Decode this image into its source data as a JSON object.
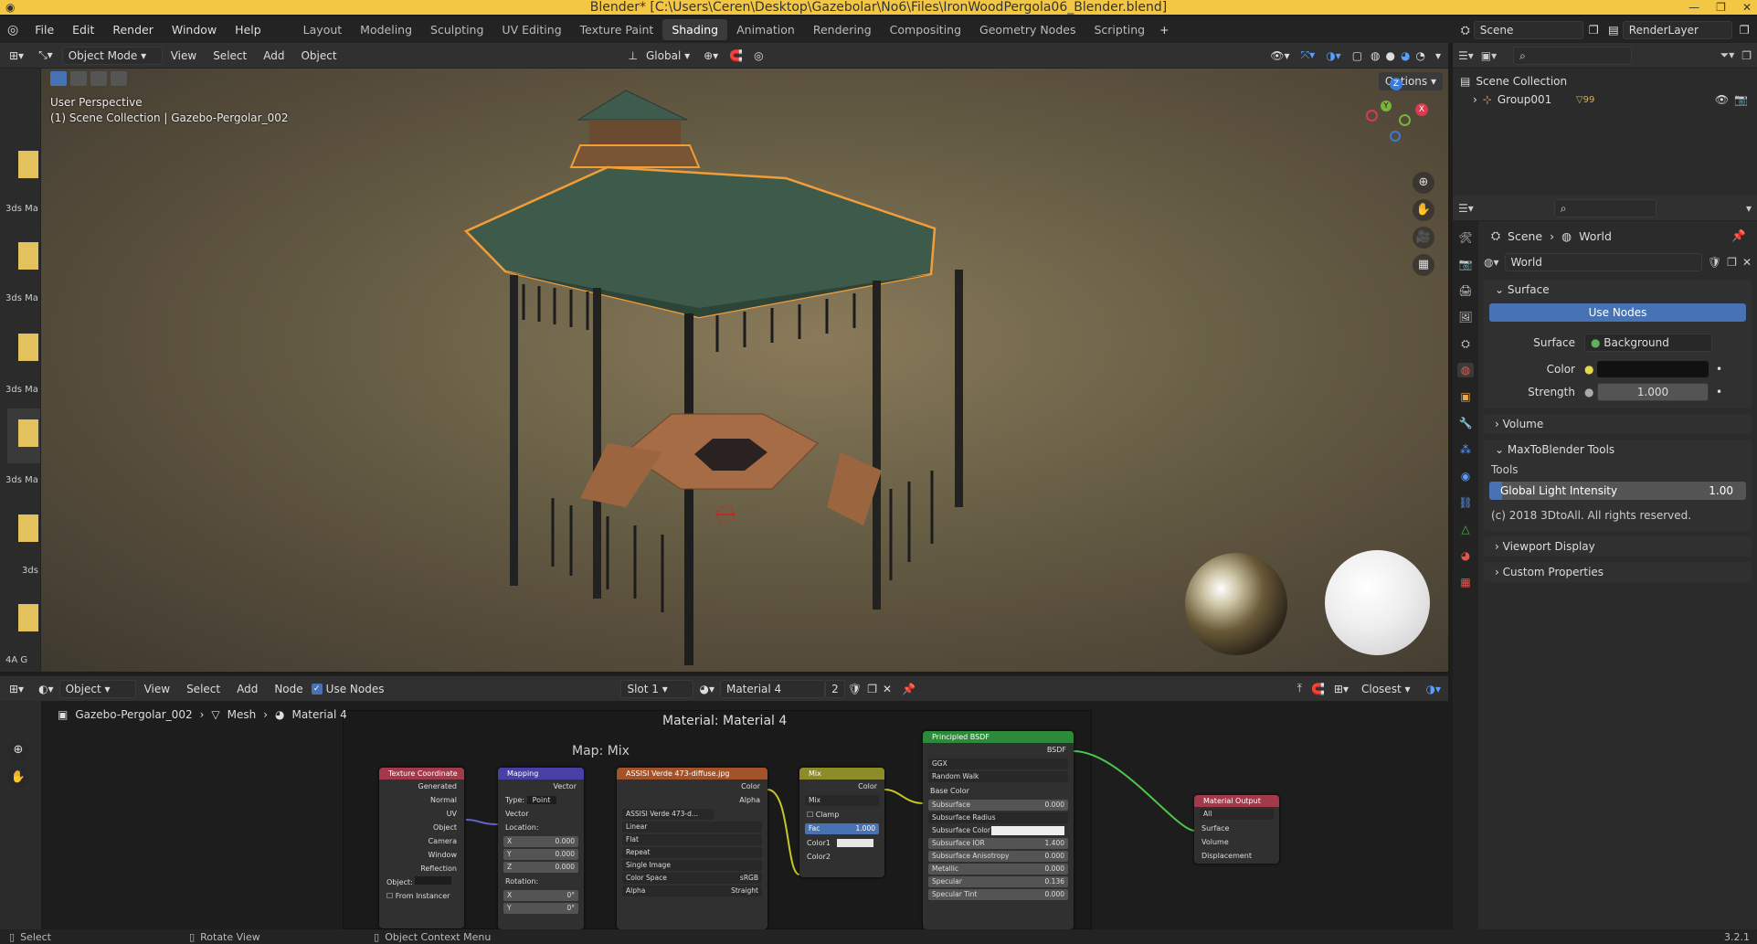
{
  "title_bar": {
    "text": "Blender* [C:\\Users\\Ceren\\Desktop\\Gazebolar\\No6\\Files\\IronWoodPergola06_Blender.blend]"
  },
  "menu": [
    "File",
    "Edit",
    "Render",
    "Window",
    "Help"
  ],
  "workspaces": [
    "Layout",
    "Modeling",
    "Sculpting",
    "UV Editing",
    "Texture Paint",
    "Shading",
    "Animation",
    "Rendering",
    "Compositing",
    "Geometry Nodes",
    "Scripting"
  ],
  "active_workspace": "Shading",
  "scene_field": "Scene",
  "renderlayer_field": "RenderLayer",
  "viewport_header": {
    "mode": "Object Mode",
    "menu": [
      "View",
      "Select",
      "Add",
      "Object"
    ],
    "transform": "Global",
    "options": "Options"
  },
  "viewport": {
    "perspective": "User Perspective",
    "collection": "(1) Scene Collection | Gazebo-Pergolar_002"
  },
  "file_browser_labels": [
    "3ds Ma",
    "3ds Ma",
    "3ds Ma",
    "3ds Ma",
    "3ds",
    "4A G"
  ],
  "outliner": {
    "root": "Scene Collection",
    "items": [
      {
        "label": "Group001",
        "badge": "99"
      }
    ]
  },
  "properties": {
    "breadcrumb": [
      "Scene",
      "World"
    ],
    "world_name": "World",
    "surface": {
      "header": "Surface",
      "use_nodes": "Use Nodes",
      "surface_label": "Surface",
      "surface_value": "Background",
      "color_label": "Color",
      "strength_label": "Strength",
      "strength_value": "1.000"
    },
    "volume": "Volume",
    "maxtoblender": {
      "header": "MaxToBlender Tools",
      "tools_label": "Tools",
      "slider_label": "Global Light Intensity",
      "slider_value": "1.00",
      "slider_fraction": 0.05,
      "copyright": "(c) 2018 3DtoAll. All rights reserved."
    },
    "viewport_display": "Viewport Display",
    "custom_properties": "Custom Properties"
  },
  "node_editor": {
    "header": {
      "type": "Object",
      "menu": [
        "View",
        "Select",
        "Add",
        "Node"
      ],
      "use_nodes": "Use Nodes",
      "slot": "Slot 1",
      "material": "Material 4",
      "users": "2",
      "snap": "Closest"
    },
    "breadcrumb": [
      "Gazebo-Pergolar_002",
      "Mesh",
      "Material 4"
    ],
    "title": "Material: Material 4",
    "frame_label": "Map: Mix",
    "nodes": {
      "texcoord": {
        "title": "Texture Coordinate",
        "outputs": [
          "Generated",
          "Normal",
          "UV",
          "Object",
          "Camera",
          "Window",
          "Reflection"
        ],
        "object": "Object:",
        "from_instancer": "From Instancer"
      },
      "mapping": {
        "title": "Mapping",
        "output": "Vector",
        "type_label": "Type:",
        "type_value": "Point",
        "vector": "Vector",
        "location": "Location:",
        "rotation": "Rotation:",
        "x": "X",
        "y": "Y",
        "z": "Z",
        "loc_values": [
          "0.000",
          "0.000",
          "0.000"
        ],
        "rot_values": [
          "0°",
          "0°"
        ]
      },
      "image": {
        "title": "ASSISI Verde 473-diffuse.jpg",
        "outputs": [
          "Color",
          "Alpha"
        ],
        "image_name": "ASSISI Verde 473-d...",
        "interp": "Linear",
        "proj": "Flat",
        "ext": "Repeat",
        "source": "Single Image",
        "cs_label": "Color Space",
        "cs_value": "sRGB",
        "alpha_label": "Alpha",
        "alpha_value": "Straight"
      },
      "mix": {
        "title": "Mix",
        "output": "Color",
        "blend": "Mix",
        "clamp": "Clamp",
        "fac_label": "Fac",
        "fac_value": "1.000",
        "color1": "Color1",
        "color2": "Color2"
      },
      "bsdf": {
        "title": "Principled BSDF",
        "output": "BSDF",
        "dist": "GGX",
        "sss": "Random Walk",
        "rows": [
          {
            "label": "Base Color",
            "value": ""
          },
          {
            "label": "Subsurface",
            "value": "0.000"
          },
          {
            "label": "Subsurface Radius",
            "value": ""
          },
          {
            "label": "Subsurface Color",
            "value": ""
          },
          {
            "label": "Subsurface IOR",
            "value": "1.400"
          },
          {
            "label": "Subsurface Anisotropy",
            "value": "0.000"
          },
          {
            "label": "Metallic",
            "value": "0.000"
          },
          {
            "label": "Specular",
            "value": "0.136"
          },
          {
            "label": "Specular Tint",
            "value": "0.000"
          }
        ]
      },
      "output": {
        "title": "Material Output",
        "target": "All",
        "inputs": [
          "Surface",
          "Volume",
          "Displacement"
        ]
      }
    }
  },
  "status": {
    "select": "Select",
    "rotate": "Rotate View",
    "context": "Object Context Menu",
    "version": "3.2.1"
  },
  "colors": {
    "accent": "#4772b3",
    "title_bar": "#f3c743",
    "selection": "#f29d38"
  }
}
